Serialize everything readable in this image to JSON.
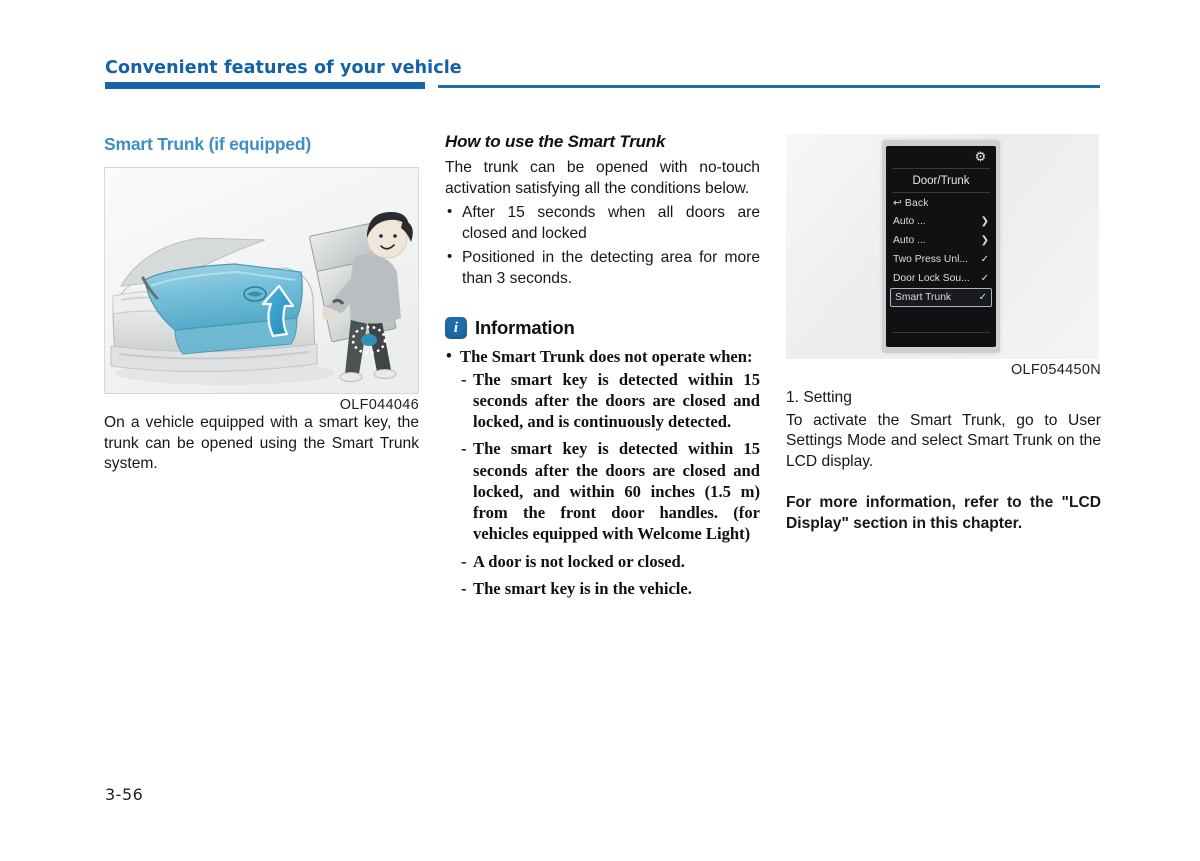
{
  "header": {
    "chapter_title": "Convenient features of your vehicle",
    "rule_color": "#1565a8"
  },
  "page_number": "3-56",
  "left_column": {
    "section_title": "Smart Trunk (if equipped)",
    "figure_caption": "OLF044046",
    "figure_alt": "Rear view of sedan with open trunk and person carrying boxes standing behind bumper",
    "paragraph": "On a vehicle equipped with a smart key, the trunk can be opened using the Smart Trunk system."
  },
  "middle_column": {
    "subhead": "How to use the Smart Trunk",
    "intro": "The trunk can be opened with no-touch activation satisfying all the conditions below.",
    "conditions": [
      "After 15 seconds when all doors are closed and locked",
      "Positioned in the detecting area for more than 3 seconds."
    ],
    "information": {
      "icon": "information-icon",
      "icon_letter": "i",
      "title": "Information",
      "lead_bullet": "The Smart Trunk does not operate when:",
      "sub_items": [
        "The smart key is detected within 15 seconds after the doors are closed and locked, and is continuously detected.",
        "The smart key is detected within 15 seconds after the doors are closed and locked, and within 60 inches (1.5 m) from the front door handles. (for vehicles equipped with Welcome Light)",
        "A door is not locked or closed.",
        "The smart key is in the vehicle."
      ]
    }
  },
  "right_column": {
    "figure_caption": "OLF054450N",
    "lcd": {
      "gear_icon": "gear-icon",
      "title": "Door/Trunk",
      "back_label": "Back",
      "back_icon": "back-arrow-icon",
      "rows": [
        {
          "label": "Auto ...",
          "control": "arrow",
          "control_glyph": "❯"
        },
        {
          "label": "Auto ...",
          "control": "arrow",
          "control_glyph": "❯"
        },
        {
          "label": "Two Press Unl...",
          "control": "check",
          "control_glyph": "✓"
        },
        {
          "label": "Door Lock Sou...",
          "control": "check",
          "control_glyph": "✓"
        },
        {
          "label": "Smart Trunk",
          "control": "check",
          "control_glyph": "✓",
          "selected": true
        }
      ]
    },
    "step_label": "1. Setting",
    "step_text": "To activate the Smart Trunk, go to User Settings Mode and select Smart Trunk on the LCD display.",
    "note_bold": "For more information, refer to the \"LCD Display\" section in this chapter."
  }
}
